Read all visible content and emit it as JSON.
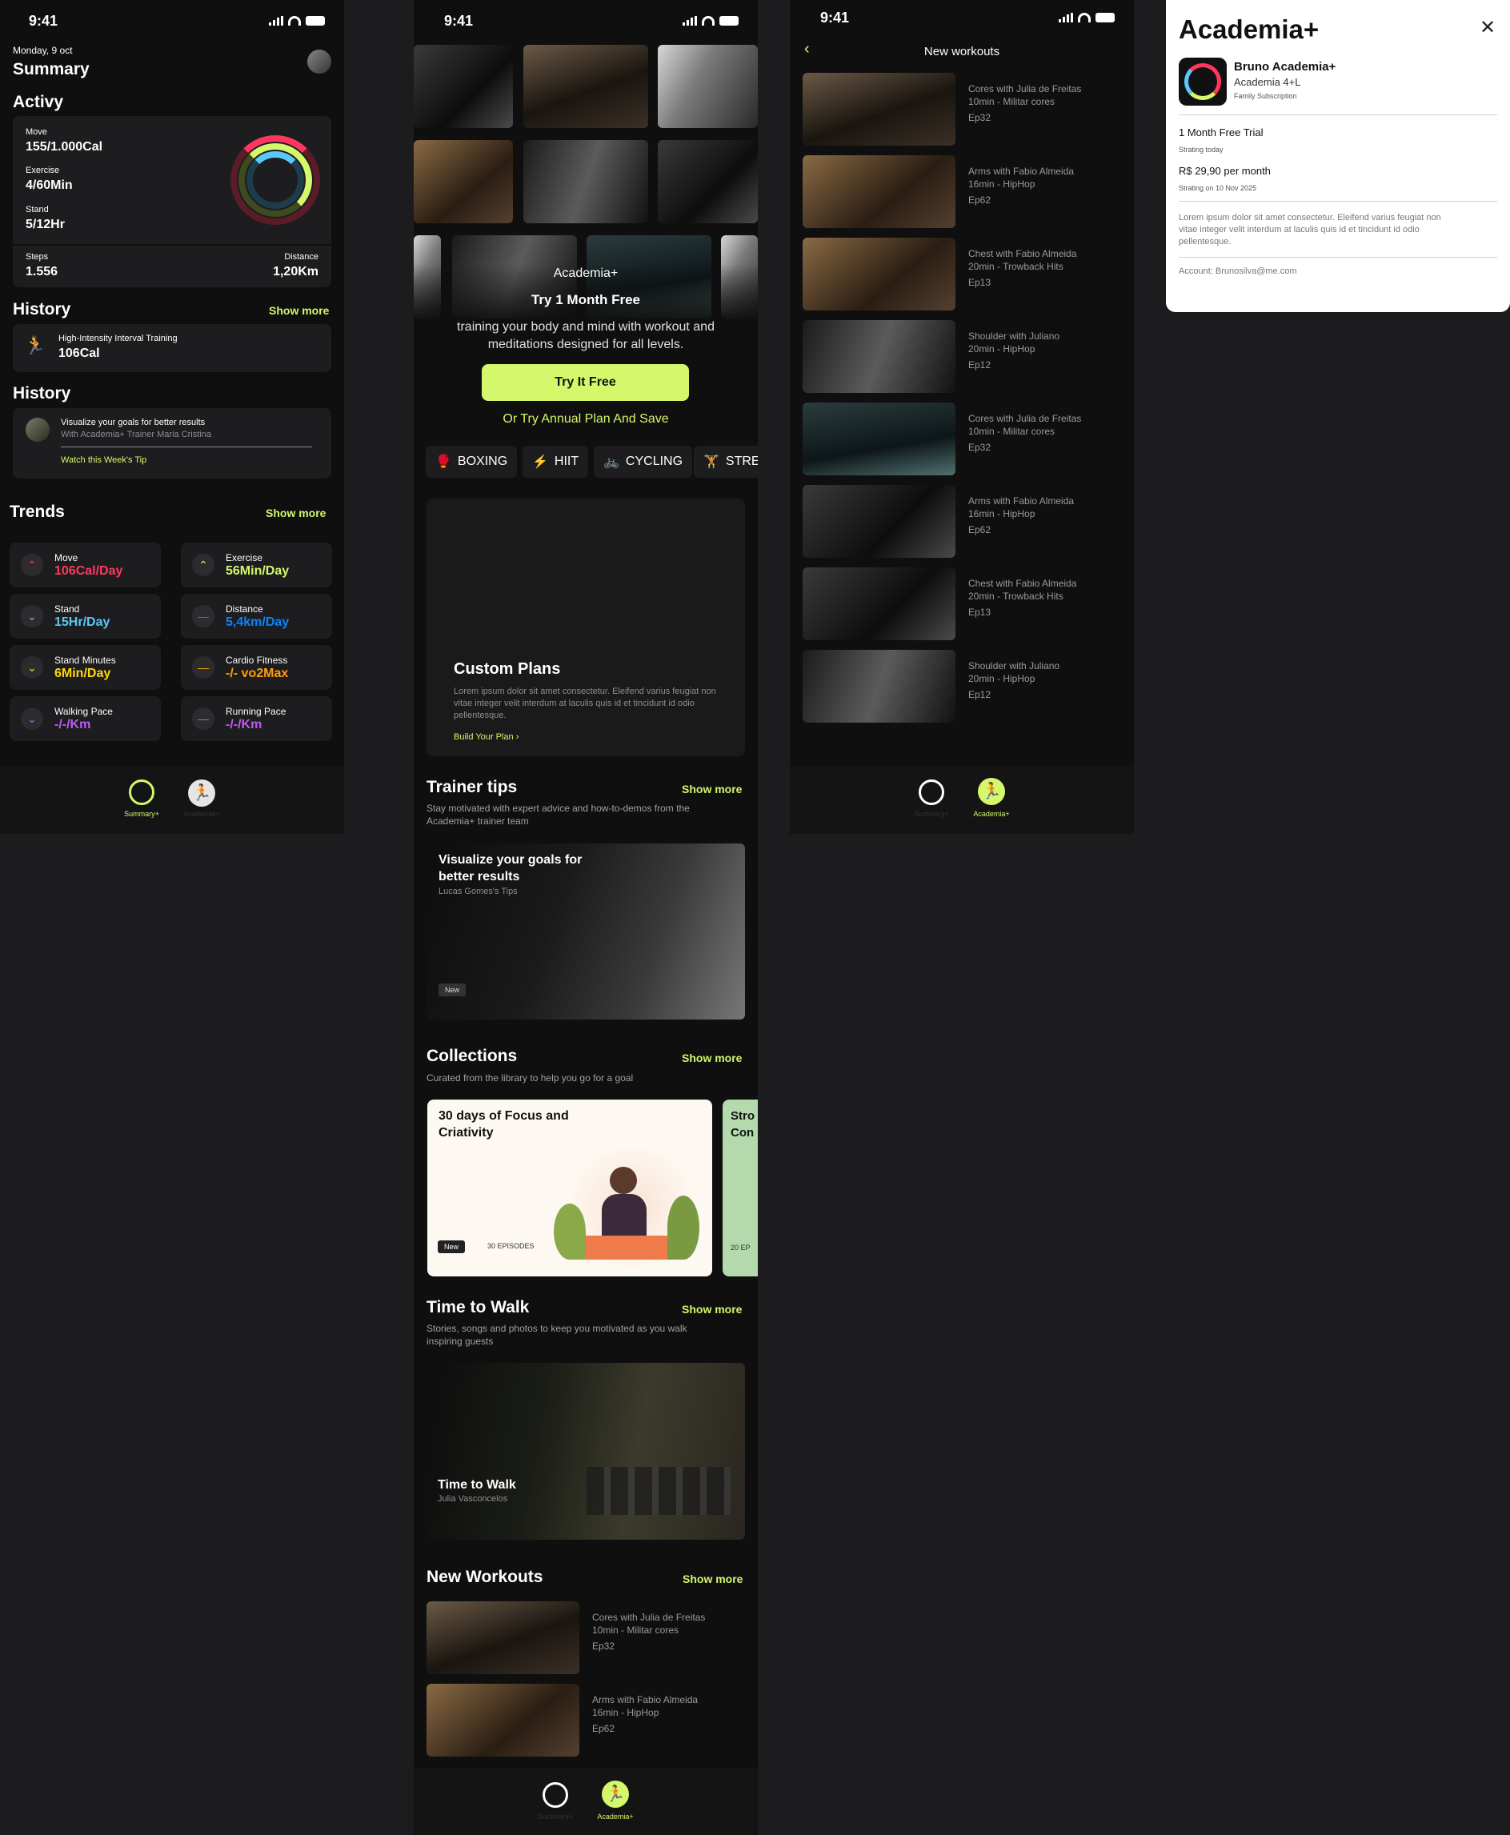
{
  "status": {
    "time": "9:41"
  },
  "summary": {
    "date": "Monday, 9 oct",
    "title": "Summary",
    "activity_title": "Activy",
    "move_label": "Move",
    "move_value": "155/1.000Cal",
    "exercise_label": "Exercise",
    "exercise_value": "4/60Min",
    "stand_label": "Stand",
    "stand_value": "5/12Hr",
    "steps_label": "Steps",
    "steps_value": "1.556",
    "distance_label": "Distance",
    "distance_value": "1,20Km",
    "history1": {
      "title": "History",
      "more": "Show more",
      "item_label": "High-Intensity Interval Training",
      "item_value": "106Cal"
    },
    "history2": {
      "title": "History",
      "tip_title": "Visualize your goals for better results",
      "tip_sub": "With Academia+ Trainer Maria Cristina",
      "tip_link": "Watch this Week's Tip"
    },
    "trends_title": "Trends",
    "trends_more": "Show more",
    "trends": [
      {
        "label": "Move",
        "value": "106Cal/Day",
        "color": "#ff375f",
        "icon": "chevron-up"
      },
      {
        "label": "Exercise",
        "value": "56Min/Day",
        "color": "#d4f76b",
        "icon": "chevron-up"
      },
      {
        "label": "Stand",
        "value": "15Hr/Day",
        "color": "#5ac8fa",
        "icon": "chevron-down"
      },
      {
        "label": "Distance",
        "value": "5,4km/Day",
        "color": "#0a84ff",
        "icon": "dash"
      },
      {
        "label": "Stand Minutes",
        "value": "6Min/Day",
        "color": "#ffd60a",
        "icon": "chevron-down"
      },
      {
        "label": "Cardio Fitness",
        "value": "-/- vo2Max",
        "color": "#ff9f0a",
        "icon": "dash"
      },
      {
        "label": "Walking Pace",
        "value": "-/-/Km",
        "color": "#bf5af2",
        "icon": "chevron-down"
      },
      {
        "label": "Running Pace",
        "value": "-/-/Km",
        "color": "#bf5af2",
        "icon": "dash"
      }
    ],
    "tabs": {
      "summary": "Summary+",
      "academia": "Academia+"
    }
  },
  "academia": {
    "promo_brand": "Academia+",
    "promo_title": "Try 1 Month Free",
    "promo_desc": "training your body and mind with workout and meditations designed for all levels.",
    "cta": "Try It Free",
    "annual": "Or Try Annual Plan And Save",
    "chips": [
      "BOXING",
      "HIIT",
      "CYCLING",
      "STRE"
    ],
    "custom_title": "Custom Plans",
    "custom_desc": "Lorem ipsum dolor sit amet consectetur. Eleifend varius feugiat non vitae integer velit interdum at laculis quis id et tincidunt id odio pellentesque.",
    "custom_link": "Build Your Plan",
    "tips_title": "Trainer tips",
    "tips_more": "Show more",
    "tips_sub": "Stay motivated with expert advice and how-to-demos from the Academia+ trainer team",
    "tip_card_title": "Visualize your goals for better results",
    "tip_card_sub": "Lucas Gomes's Tips",
    "tip_card_tag": "New",
    "collections_title": "Collections",
    "collections_more": "Show more",
    "collections_sub": "Curated from the library to help you go for a goal",
    "collection1_title": "30 days of Focus and Criativity",
    "collection1_tag": "New",
    "collection1_count": "30 EPISODES",
    "collection2_title": "Stro Con",
    "collection2_count": "20 EP",
    "walk_title": "Time to Walk",
    "walk_more": "Show more",
    "walk_sub": "Stories, songs and photos to keep you motivated as you walk inspiring guests",
    "walk_card_title": "Time to Walk",
    "walk_card_sub": "Julia Vasconcelos",
    "nw_title": "New Workouts",
    "nw_more": "Show more",
    "tabs": {
      "summary": "Summary+",
      "academia": "Academia+"
    }
  },
  "new_workouts": {
    "title": "New workouts",
    "items": [
      {
        "name": "Cores with Julia de Freitas",
        "meta": "10min - Militar cores",
        "ep": "Ep32"
      },
      {
        "name": "Arms with Fabio Almeida",
        "meta": "16min - HipHop",
        "ep": "Ep62"
      },
      {
        "name": "Chest with Fabio Almeida",
        "meta": "20min - Trowback Hits",
        "ep": "Ep13"
      },
      {
        "name": "Shoulder with Juliano",
        "meta": "20min - HipHop",
        "ep": "Ep12"
      },
      {
        "name": "Cores with Julia de Freitas",
        "meta": "10min - Militar cores",
        "ep": "Ep32"
      },
      {
        "name": "Arms with Fabio Almeida",
        "meta": "16min - HipHop",
        "ep": "Ep62"
      },
      {
        "name": "Chest with Fabio Almeida",
        "meta": "20min - Trowback Hits",
        "ep": "Ep13"
      },
      {
        "name": "Shoulder with Juliano",
        "meta": "20min - HipHop",
        "ep": "Ep12"
      }
    ],
    "tabs": {
      "summary": "Summary+",
      "academia": "Academia+"
    }
  },
  "subscription": {
    "title": "Academia+",
    "user": "Bruno Academia+",
    "plan": "Academia 4+L",
    "plan_type": "Family Subscription",
    "trial": "1 Month Free Trial",
    "trial_start": "Strating today",
    "price": "R$ 29,90 per month",
    "price_start": "Strating on 10 Nov 2025",
    "desc": "Lorem ipsum dolor sit amet consectetur. Eleifend varius feugiat non vitae integer velit interdum at laculis quis id et tincidunt id odio pellentesque.",
    "account": "Account: Brunosilva@me.com"
  }
}
